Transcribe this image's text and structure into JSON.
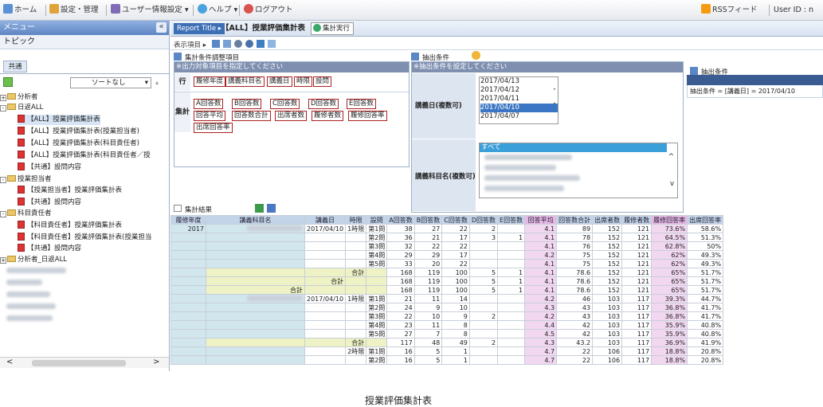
{
  "topbar": {
    "home": "ホーム",
    "settings": "設定・管理",
    "user_info": "ユーザー情報設定 ▾",
    "help": "ヘルプ ▾",
    "logout": "ログアウト",
    "rss": "RSSフィード",
    "user_id": "User ID : n"
  },
  "left": {
    "menu_title": "メニュー",
    "collapse": "«",
    "topic": "トピック",
    "tab_common": "共通",
    "sort_label": "ソートなし",
    "scroll_left": "<",
    "scroll_right": ">",
    "tree": [
      "分析者",
      "日返ALL",
      "【ALL】授業評価集計表",
      "【ALL】授業評価集計表(授業担当者)",
      "【ALL】授業評価集計表(科目責任者)",
      "【ALL】授業評価集計表(科目責任者／授",
      "【共通】設問内容",
      "授業担当者",
      "【授業担当者】授業評価集計表",
      "【共通】設問内容",
      "科目責任者",
      "【科目責任者】授業評価集計表",
      "【科目責任者】授業評価集計表(授業担当",
      "【共通】設問内容",
      "分析者_日返ALL"
    ]
  },
  "tabs": {
    "report_title": "Report Title ▸",
    "report_name": "【ALL】授業評価集計表",
    "run": "集計実行"
  },
  "toolbar": {
    "display": "表示項目 ▸"
  },
  "cond": {
    "header": "集計条件調整項目",
    "hint": "※出力対象項目を指定してください",
    "row_label": "行",
    "agg_label": "集計",
    "row_buttons": [
      "履修年度",
      "講義科目名",
      "講義日",
      "時限",
      "設問"
    ],
    "agg_buttons": [
      "A回答数",
      "B回答数",
      "C回答数",
      "D回答数",
      "E回答数",
      "回答平均",
      "回答数合計",
      "出席者数",
      "履修者数",
      "履修回答率",
      "出席回答率"
    ]
  },
  "extract": {
    "header": "抽出条件",
    "hint": "※抽出条件を設定してください",
    "date_label": "講義日(複数可)",
    "dates": [
      "2017/04/13",
      "2017/04/12",
      "2017/04/11",
      "2017/04/10",
      "2017/04/07"
    ],
    "date_selected": "2017/04/10",
    "subject_label": "講義科目名(複数可)",
    "all": "すべて"
  },
  "rcond": {
    "header": "抽出条件",
    "text": "抽出条件 = [講義日] = 2017/04/10"
  },
  "results": {
    "header": "集計結果",
    "columns": [
      "履修年度",
      "講義科目名",
      "講義日",
      "時限",
      "設問",
      "A回答数",
      "B回答数",
      "C回答数",
      "D回答数",
      "E回答数",
      "回答平均",
      "回答数合計",
      "出席者数",
      "履修者数",
      "履修回答率",
      "出席回答率"
    ],
    "rows": [
      [
        "2017",
        "",
        "2017/04/10",
        "1時限",
        "第1問",
        "38",
        "27",
        "22",
        "2",
        "",
        "4.1",
        "89",
        "152",
        "121",
        "73.6%",
        "58.6%"
      ],
      [
        "",
        "",
        "",
        "",
        "第2問",
        "36",
        "21",
        "17",
        "3",
        "1",
        "4.1",
        "78",
        "152",
        "121",
        "64.5%",
        "51.3%"
      ],
      [
        "",
        "",
        "",
        "",
        "第3問",
        "32",
        "22",
        "22",
        "",
        "",
        "4.1",
        "76",
        "152",
        "121",
        "62.8%",
        "50%"
      ],
      [
        "",
        "",
        "",
        "",
        "第4問",
        "29",
        "29",
        "17",
        "",
        "",
        "4.2",
        "75",
        "152",
        "121",
        "62%",
        "49.3%"
      ],
      [
        "",
        "",
        "",
        "",
        "第5問",
        "33",
        "20",
        "22",
        "",
        "",
        "4.1",
        "75",
        "152",
        "121",
        "62%",
        "49.3%"
      ],
      [
        "",
        "",
        "",
        "合計",
        "",
        "168",
        "119",
        "100",
        "5",
        "1",
        "4.1",
        "78.6",
        "152",
        "121",
        "65%",
        "51.7%"
      ],
      [
        "",
        "",
        "合計",
        "",
        "",
        "168",
        "119",
        "100",
        "5",
        "1",
        "4.1",
        "78.6",
        "152",
        "121",
        "65%",
        "51.7%"
      ],
      [
        "",
        "合計",
        "",
        "",
        "",
        "168",
        "119",
        "100",
        "5",
        "1",
        "4.1",
        "78.6",
        "152",
        "121",
        "65%",
        "51.7%"
      ],
      [
        "",
        "",
        "2017/04/10",
        "1時限",
        "第1問",
        "21",
        "11",
        "14",
        "",
        "",
        "4.2",
        "46",
        "103",
        "117",
        "39.3%",
        "44.7%"
      ],
      [
        "",
        "",
        "",
        "",
        "第2問",
        "24",
        "9",
        "10",
        "",
        "",
        "4.3",
        "43",
        "103",
        "117",
        "36.8%",
        "41.7%"
      ],
      [
        "",
        "",
        "",
        "",
        "第3問",
        "22",
        "10",
        "9",
        "2",
        "",
        "4.2",
        "43",
        "103",
        "117",
        "36.8%",
        "41.7%"
      ],
      [
        "",
        "",
        "",
        "",
        "第4問",
        "23",
        "11",
        "8",
        "",
        "",
        "4.4",
        "42",
        "103",
        "117",
        "35.9%",
        "40.8%"
      ],
      [
        "",
        "",
        "",
        "",
        "第5問",
        "27",
        "7",
        "8",
        "",
        "",
        "4.5",
        "42",
        "103",
        "117",
        "35.9%",
        "40.8%"
      ],
      [
        "",
        "",
        "",
        "合計",
        "",
        "117",
        "48",
        "49",
        "2",
        "",
        "4.3",
        "43.2",
        "103",
        "117",
        "36.9%",
        "41.9%"
      ],
      [
        "",
        "",
        "",
        "2時限",
        "第1問",
        "16",
        "5",
        "1",
        "",
        "",
        "4.7",
        "22",
        "106",
        "117",
        "18.8%",
        "20.8%"
      ],
      [
        "",
        "",
        "",
        "",
        "第2問",
        "16",
        "5",
        "1",
        "",
        "",
        "4.7",
        "22",
        "106",
        "117",
        "18.8%",
        "20.8%"
      ]
    ]
  },
  "caption": "授業評価集計表"
}
